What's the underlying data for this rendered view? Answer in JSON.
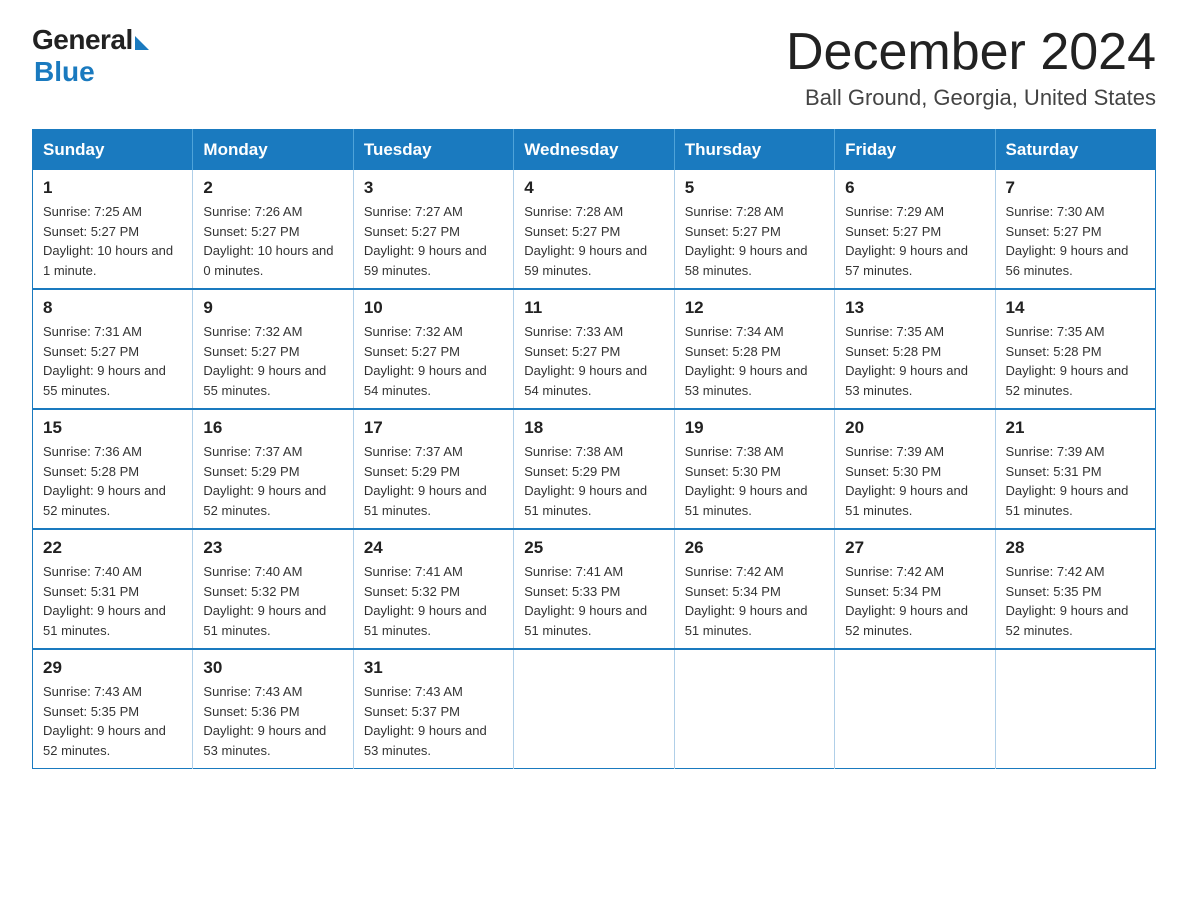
{
  "logo": {
    "general": "General",
    "blue": "Blue"
  },
  "title": "December 2024",
  "subtitle": "Ball Ground, Georgia, United States",
  "weekdays": [
    "Sunday",
    "Monday",
    "Tuesday",
    "Wednesday",
    "Thursday",
    "Friday",
    "Saturday"
  ],
  "weeks": [
    [
      {
        "day": "1",
        "sunrise": "7:25 AM",
        "sunset": "5:27 PM",
        "daylight": "10 hours and 1 minute."
      },
      {
        "day": "2",
        "sunrise": "7:26 AM",
        "sunset": "5:27 PM",
        "daylight": "10 hours and 0 minutes."
      },
      {
        "day": "3",
        "sunrise": "7:27 AM",
        "sunset": "5:27 PM",
        "daylight": "9 hours and 59 minutes."
      },
      {
        "day": "4",
        "sunrise": "7:28 AM",
        "sunset": "5:27 PM",
        "daylight": "9 hours and 59 minutes."
      },
      {
        "day": "5",
        "sunrise": "7:28 AM",
        "sunset": "5:27 PM",
        "daylight": "9 hours and 58 minutes."
      },
      {
        "day": "6",
        "sunrise": "7:29 AM",
        "sunset": "5:27 PM",
        "daylight": "9 hours and 57 minutes."
      },
      {
        "day": "7",
        "sunrise": "7:30 AM",
        "sunset": "5:27 PM",
        "daylight": "9 hours and 56 minutes."
      }
    ],
    [
      {
        "day": "8",
        "sunrise": "7:31 AM",
        "sunset": "5:27 PM",
        "daylight": "9 hours and 55 minutes."
      },
      {
        "day": "9",
        "sunrise": "7:32 AM",
        "sunset": "5:27 PM",
        "daylight": "9 hours and 55 minutes."
      },
      {
        "day": "10",
        "sunrise": "7:32 AM",
        "sunset": "5:27 PM",
        "daylight": "9 hours and 54 minutes."
      },
      {
        "day": "11",
        "sunrise": "7:33 AM",
        "sunset": "5:27 PM",
        "daylight": "9 hours and 54 minutes."
      },
      {
        "day": "12",
        "sunrise": "7:34 AM",
        "sunset": "5:28 PM",
        "daylight": "9 hours and 53 minutes."
      },
      {
        "day": "13",
        "sunrise": "7:35 AM",
        "sunset": "5:28 PM",
        "daylight": "9 hours and 53 minutes."
      },
      {
        "day": "14",
        "sunrise": "7:35 AM",
        "sunset": "5:28 PM",
        "daylight": "9 hours and 52 minutes."
      }
    ],
    [
      {
        "day": "15",
        "sunrise": "7:36 AM",
        "sunset": "5:28 PM",
        "daylight": "9 hours and 52 minutes."
      },
      {
        "day": "16",
        "sunrise": "7:37 AM",
        "sunset": "5:29 PM",
        "daylight": "9 hours and 52 minutes."
      },
      {
        "day": "17",
        "sunrise": "7:37 AM",
        "sunset": "5:29 PM",
        "daylight": "9 hours and 51 minutes."
      },
      {
        "day": "18",
        "sunrise": "7:38 AM",
        "sunset": "5:29 PM",
        "daylight": "9 hours and 51 minutes."
      },
      {
        "day": "19",
        "sunrise": "7:38 AM",
        "sunset": "5:30 PM",
        "daylight": "9 hours and 51 minutes."
      },
      {
        "day": "20",
        "sunrise": "7:39 AM",
        "sunset": "5:30 PM",
        "daylight": "9 hours and 51 minutes."
      },
      {
        "day": "21",
        "sunrise": "7:39 AM",
        "sunset": "5:31 PM",
        "daylight": "9 hours and 51 minutes."
      }
    ],
    [
      {
        "day": "22",
        "sunrise": "7:40 AM",
        "sunset": "5:31 PM",
        "daylight": "9 hours and 51 minutes."
      },
      {
        "day": "23",
        "sunrise": "7:40 AM",
        "sunset": "5:32 PM",
        "daylight": "9 hours and 51 minutes."
      },
      {
        "day": "24",
        "sunrise": "7:41 AM",
        "sunset": "5:32 PM",
        "daylight": "9 hours and 51 minutes."
      },
      {
        "day": "25",
        "sunrise": "7:41 AM",
        "sunset": "5:33 PM",
        "daylight": "9 hours and 51 minutes."
      },
      {
        "day": "26",
        "sunrise": "7:42 AM",
        "sunset": "5:34 PM",
        "daylight": "9 hours and 51 minutes."
      },
      {
        "day": "27",
        "sunrise": "7:42 AM",
        "sunset": "5:34 PM",
        "daylight": "9 hours and 52 minutes."
      },
      {
        "day": "28",
        "sunrise": "7:42 AM",
        "sunset": "5:35 PM",
        "daylight": "9 hours and 52 minutes."
      }
    ],
    [
      {
        "day": "29",
        "sunrise": "7:43 AM",
        "sunset": "5:35 PM",
        "daylight": "9 hours and 52 minutes."
      },
      {
        "day": "30",
        "sunrise": "7:43 AM",
        "sunset": "5:36 PM",
        "daylight": "9 hours and 53 minutes."
      },
      {
        "day": "31",
        "sunrise": "7:43 AM",
        "sunset": "5:37 PM",
        "daylight": "9 hours and 53 minutes."
      },
      null,
      null,
      null,
      null
    ]
  ]
}
